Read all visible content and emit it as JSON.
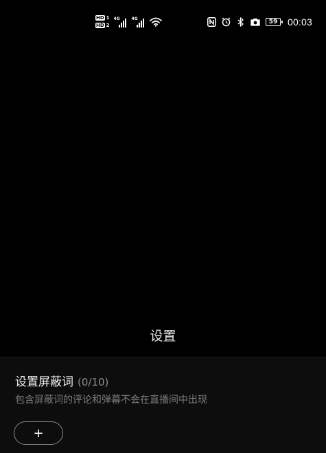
{
  "status_bar": {
    "sim1_label": "HD",
    "sim1_index": "1",
    "sim2_label": "HD",
    "sim2_index": "2",
    "network1": "4G",
    "network2": "4G",
    "icons": [
      "nfc-icon",
      "alarm-icon",
      "bluetooth-icon",
      "camera-icon"
    ],
    "battery_level": "59",
    "time": "00:03"
  },
  "page": {
    "title": "设置"
  },
  "blocked_words": {
    "title": "设置屏蔽词",
    "count": "(0/10)",
    "description": "包含屏蔽词的评论和弹幕不会在直播间中出现",
    "add_label": "+"
  }
}
